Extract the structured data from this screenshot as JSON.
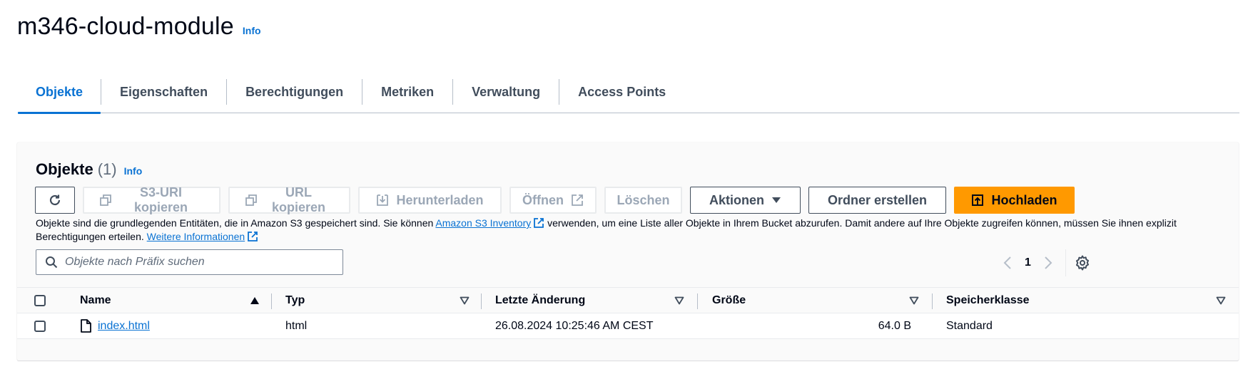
{
  "header": {
    "title": "m346-cloud-module",
    "info": "Info"
  },
  "tabs": [
    {
      "label": "Objekte",
      "active": true
    },
    {
      "label": "Eigenschaften"
    },
    {
      "label": "Berechtigungen"
    },
    {
      "label": "Metriken"
    },
    {
      "label": "Verwaltung"
    },
    {
      "label": "Access Points"
    }
  ],
  "objects_panel": {
    "title": "Objekte",
    "count": "(1)",
    "info": "Info",
    "toolbar": {
      "copy_s3_uri": "S3-URI kopieren",
      "copy_url": "URL kopieren",
      "download": "Herunterladen",
      "open": "Öffnen",
      "delete": "Löschen",
      "actions": "Aktionen",
      "create_folder": "Ordner erstellen",
      "upload": "Hochladen"
    },
    "description": {
      "part1": "Objekte sind die grundlegenden Entitäten, die in Amazon S3 gespeichert sind. Sie können ",
      "inventory_link": "Amazon S3 Inventory",
      "part2": " verwenden, um eine Liste aller Objekte in Ihrem Bucket abzurufen. Damit andere auf Ihre Objekte zugreifen können, müssen Sie ihnen explizit Berechtigungen erteilen. ",
      "more_link": "Weitere Informationen"
    },
    "search": {
      "placeholder": "Objekte nach Präfix suchen",
      "value": ""
    },
    "pagination": {
      "current_page": "1"
    },
    "table": {
      "columns": {
        "name": "Name",
        "type": "Typ",
        "modified": "Letzte Änderung",
        "size": "Größe",
        "storage_class": "Speicherklasse"
      },
      "rows": [
        {
          "name": "index.html",
          "type": "html",
          "modified": "26.08.2024 10:25:46 AM CEST",
          "size": "64.0 B",
          "storage_class": "Standard"
        }
      ]
    }
  },
  "colors": {
    "accent_blue": "#0972d3",
    "primary_orange": "#ff9900",
    "text_dark": "#000716",
    "disabled_text": "#9ba7b6"
  }
}
